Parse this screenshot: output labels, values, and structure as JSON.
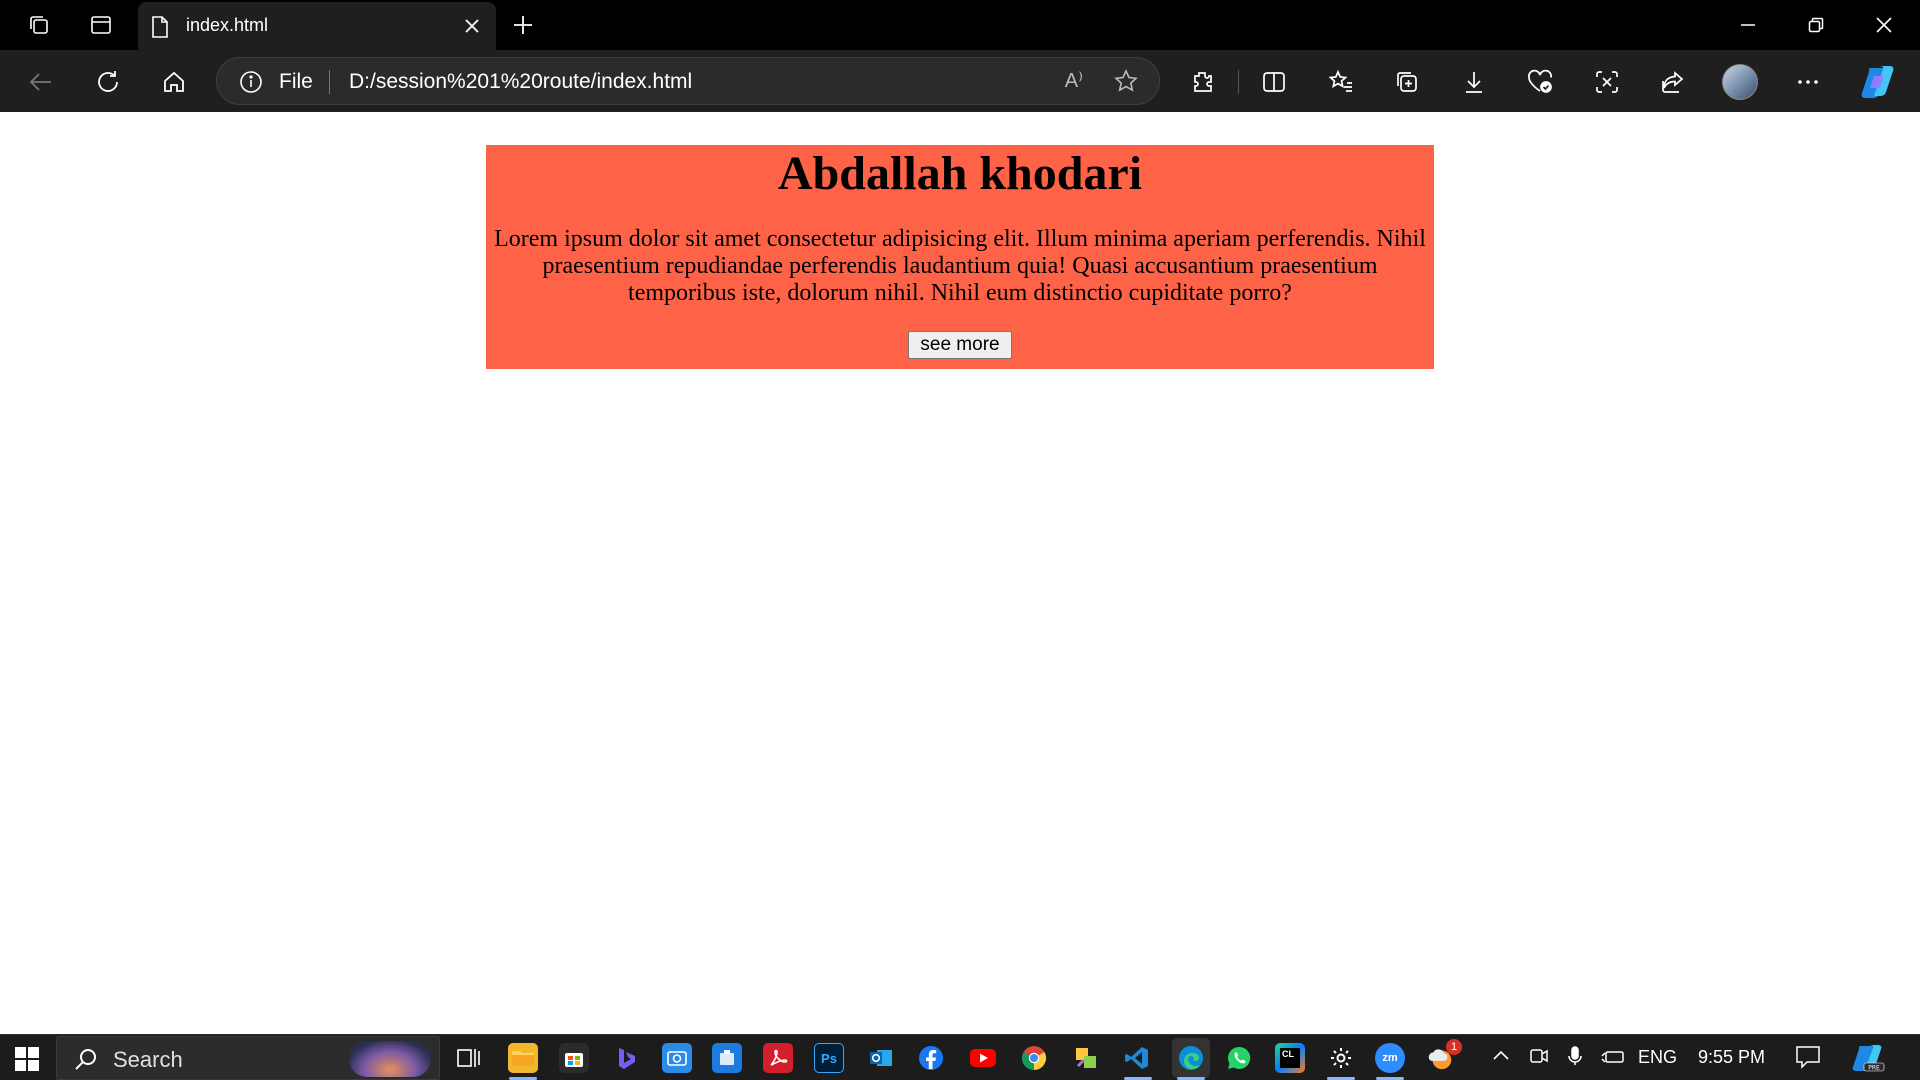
{
  "browser": {
    "tab": {
      "title": "index.html",
      "icon": "document-icon"
    },
    "window_controls": [
      "minimize-icon",
      "restore-icon",
      "close-icon"
    ],
    "address": {
      "protocol_label": "File",
      "url": "D:/session%201%20route/index.html",
      "read_aloud_label": "A⁾"
    }
  },
  "page": {
    "heading": "Abdallah khodari",
    "paragraph": "Lorem ipsum dolor sit amet consectetur adipisicing elit. Illum minima aperiam perferendis. Nihil praesentium repudiandae perferendis laudantium quia! Quasi accusantium praesentium temporibus iste, dolorum nihil. Nihil eum distinctio cupiditate porro?",
    "button_label": "see more",
    "card_color": "#ff6347"
  },
  "taskbar": {
    "search_label": "Search",
    "language": "ENG",
    "time": "9:55 PM",
    "notification_count": "1",
    "apps": [
      "Task View",
      "File Explorer",
      "Microsoft Store",
      "Bing",
      "Camera",
      "Company Portal",
      "Acrobat",
      "Photoshop",
      "Outlook",
      "Facebook",
      "YouTube",
      "Chrome",
      "Sticky Notes",
      "VS Code",
      "Edge",
      "WhatsApp",
      "CLion",
      "Settings",
      "Zoom",
      "Weather"
    ]
  }
}
